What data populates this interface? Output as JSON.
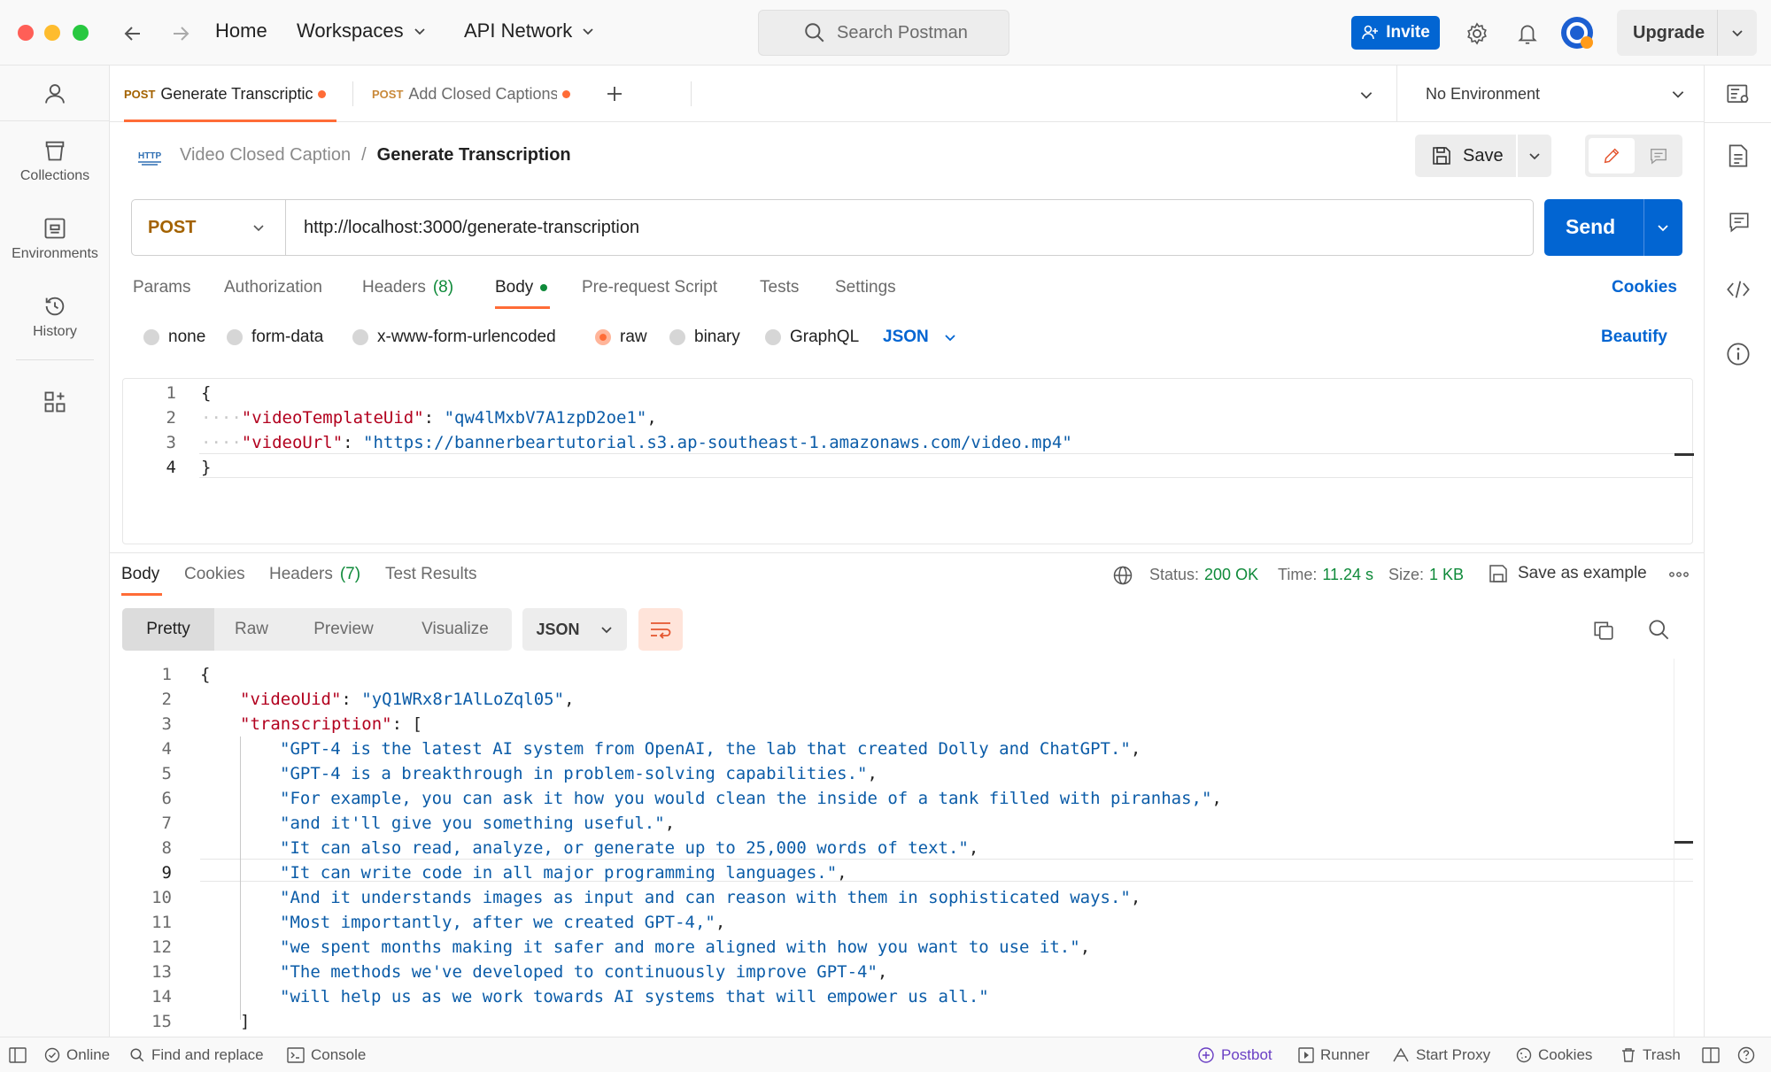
{
  "window": {
    "nav": {
      "home": "Home",
      "workspaces": "Workspaces",
      "api_network": "API Network"
    },
    "search_placeholder": "Search Postman",
    "invite_label": "Invite",
    "upgrade_label": "Upgrade"
  },
  "sidebar": {
    "items": [
      {
        "label": "Collections"
      },
      {
        "label": "Environments"
      },
      {
        "label": "History"
      }
    ]
  },
  "tabs": [
    {
      "method": "POST",
      "label": "Generate Transcriptic",
      "active": true
    },
    {
      "method": "POST",
      "label": "Add Closed Captions",
      "active": false
    }
  ],
  "environment": {
    "label": "No Environment"
  },
  "breadcrumb": {
    "collection": "Video Closed Caption",
    "separator": "/",
    "request": "Generate Transcription"
  },
  "save_label": "Save",
  "request": {
    "method": "POST",
    "url": "http://localhost:3000/generate-transcription",
    "send_label": "Send",
    "tabs": [
      {
        "label": "Params"
      },
      {
        "label": "Authorization"
      },
      {
        "label": "Headers",
        "count": "(8)"
      },
      {
        "label": "Body"
      },
      {
        "label": "Pre-request Script"
      },
      {
        "label": "Tests"
      },
      {
        "label": "Settings"
      }
    ],
    "cookies_label": "Cookies",
    "body_modes": [
      "none",
      "form-data",
      "x-www-form-urlencoded",
      "raw",
      "binary",
      "GraphQL"
    ],
    "body_format": "JSON",
    "beautify_label": "Beautify",
    "body_lines": [
      {
        "n": "1",
        "text": "{"
      },
      {
        "n": "2",
        "key": "\"videoTemplateUid\"",
        "sep": ": ",
        "val": "\"qw4lMxbV7A1zpD2oe1\"",
        "end": ","
      },
      {
        "n": "3",
        "key": "\"videoUrl\"",
        "sep": ": ",
        "val": "\"https://bannerbeartutorial.s3.ap-southeast-1.amazonaws.com/video.mp4\"",
        "end": ""
      },
      {
        "n": "4",
        "text": "}"
      }
    ]
  },
  "response": {
    "tabs": [
      {
        "label": "Body"
      },
      {
        "label": "Cookies"
      },
      {
        "label": "Headers",
        "count": "(7)"
      },
      {
        "label": "Test Results"
      }
    ],
    "status_label": "Status:",
    "status_value": "200 OK",
    "time_label": "Time:",
    "time_value": "11.24 s",
    "size_label": "Size:",
    "size_value": "1 KB",
    "save_example_label": "Save as example",
    "views": [
      "Pretty",
      "Raw",
      "Preview",
      "Visualize"
    ],
    "format": "JSON",
    "lines": [
      {
        "n": "1",
        "text": "{"
      },
      {
        "n": "2",
        "key": "\"videoUid\"",
        "sep": ": ",
        "val": "\"yQ1WRx8r1AlLoZql05\"",
        "end": ","
      },
      {
        "n": "3",
        "key": "\"transcription\"",
        "sep": ": ",
        "val": "",
        "end": "["
      },
      {
        "n": "4",
        "val": "\"GPT-4 is the latest AI system from OpenAI, the lab that created Dolly and ChatGPT.\"",
        "end": ","
      },
      {
        "n": "5",
        "val": "\"GPT-4 is a breakthrough in problem-solving capabilities.\"",
        "end": ","
      },
      {
        "n": "6",
        "val": "\"For example, you can ask it how you would clean the inside of a tank filled with piranhas,\"",
        "end": ","
      },
      {
        "n": "7",
        "val": "\"and it'll give you something useful.\"",
        "end": ","
      },
      {
        "n": "8",
        "val": "\"It can also read, analyze, or generate up to 25,000 words of text.\"",
        "end": ","
      },
      {
        "n": "9",
        "val": "\"It can write code in all major programming languages.\"",
        "end": ","
      },
      {
        "n": "10",
        "val": "\"And it understands images as input and can reason with them in sophisticated ways.\"",
        "end": ","
      },
      {
        "n": "11",
        "val": "\"Most importantly, after we created GPT-4,\"",
        "end": ","
      },
      {
        "n": "12",
        "val": "\"we spent months making it safer and more aligned with how you want to use it.\"",
        "end": ","
      },
      {
        "n": "13",
        "val": "\"The methods we've developed to continuously improve GPT-4\"",
        "end": ","
      },
      {
        "n": "14",
        "val": "\"will help us as we work towards AI systems that will empower us all.\"",
        "end": ""
      },
      {
        "n": "15",
        "text": "]"
      }
    ]
  },
  "statusbar": {
    "online": "Online",
    "find_replace": "Find and replace",
    "console": "Console",
    "postbot": "Postbot",
    "runner": "Runner",
    "start_proxy": "Start Proxy",
    "cookies": "Cookies",
    "trash": "Trash"
  },
  "colors": {
    "accent": "#0265d2",
    "method": "#a36200",
    "status_ok": "#0f8a3a",
    "json_key": "#b2001e",
    "json_string": "#0b5ca8",
    "active_tab": "#ff6c37"
  }
}
